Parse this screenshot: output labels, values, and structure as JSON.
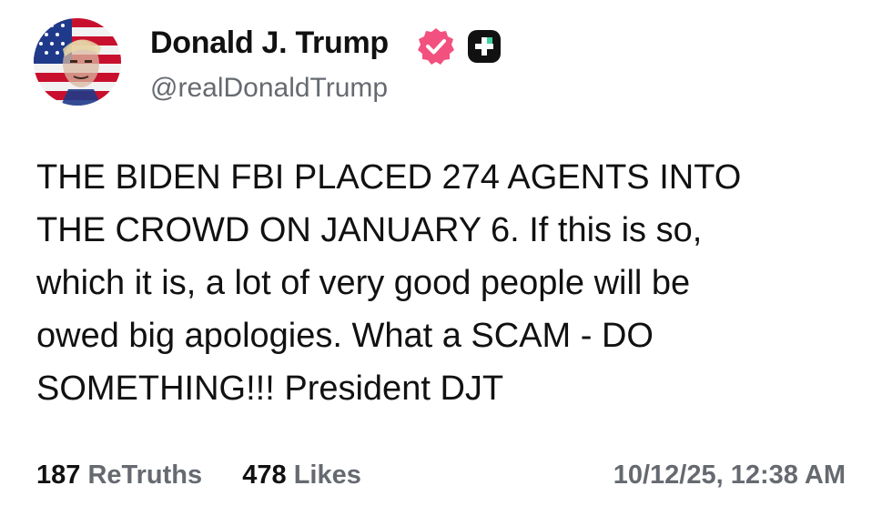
{
  "author": {
    "display_name": "Donald J. Trump",
    "handle": "@realDonaldTrump",
    "avatar_icon": "profile-avatar-flag",
    "verified_icon": "verified-badge-icon",
    "plus_icon": "plus-badge-icon",
    "verified_color": "#f2517f"
  },
  "post": {
    "lines": [
      "THE BIDEN FBI PLACED 274 AGENTS INTO",
      "THE CROWD ON JANUARY 6. If this is so,",
      "which it is, a lot of very good people will be",
      "owed big apologies. What a SCAM - DO",
      "SOMETHING!!! President DJT"
    ]
  },
  "stats": {
    "retruths_count": "187",
    "retruths_label": "ReTruths",
    "likes_count": "478",
    "likes_label": "Likes"
  },
  "timestamp": "10/12/25, 12:38 AM"
}
